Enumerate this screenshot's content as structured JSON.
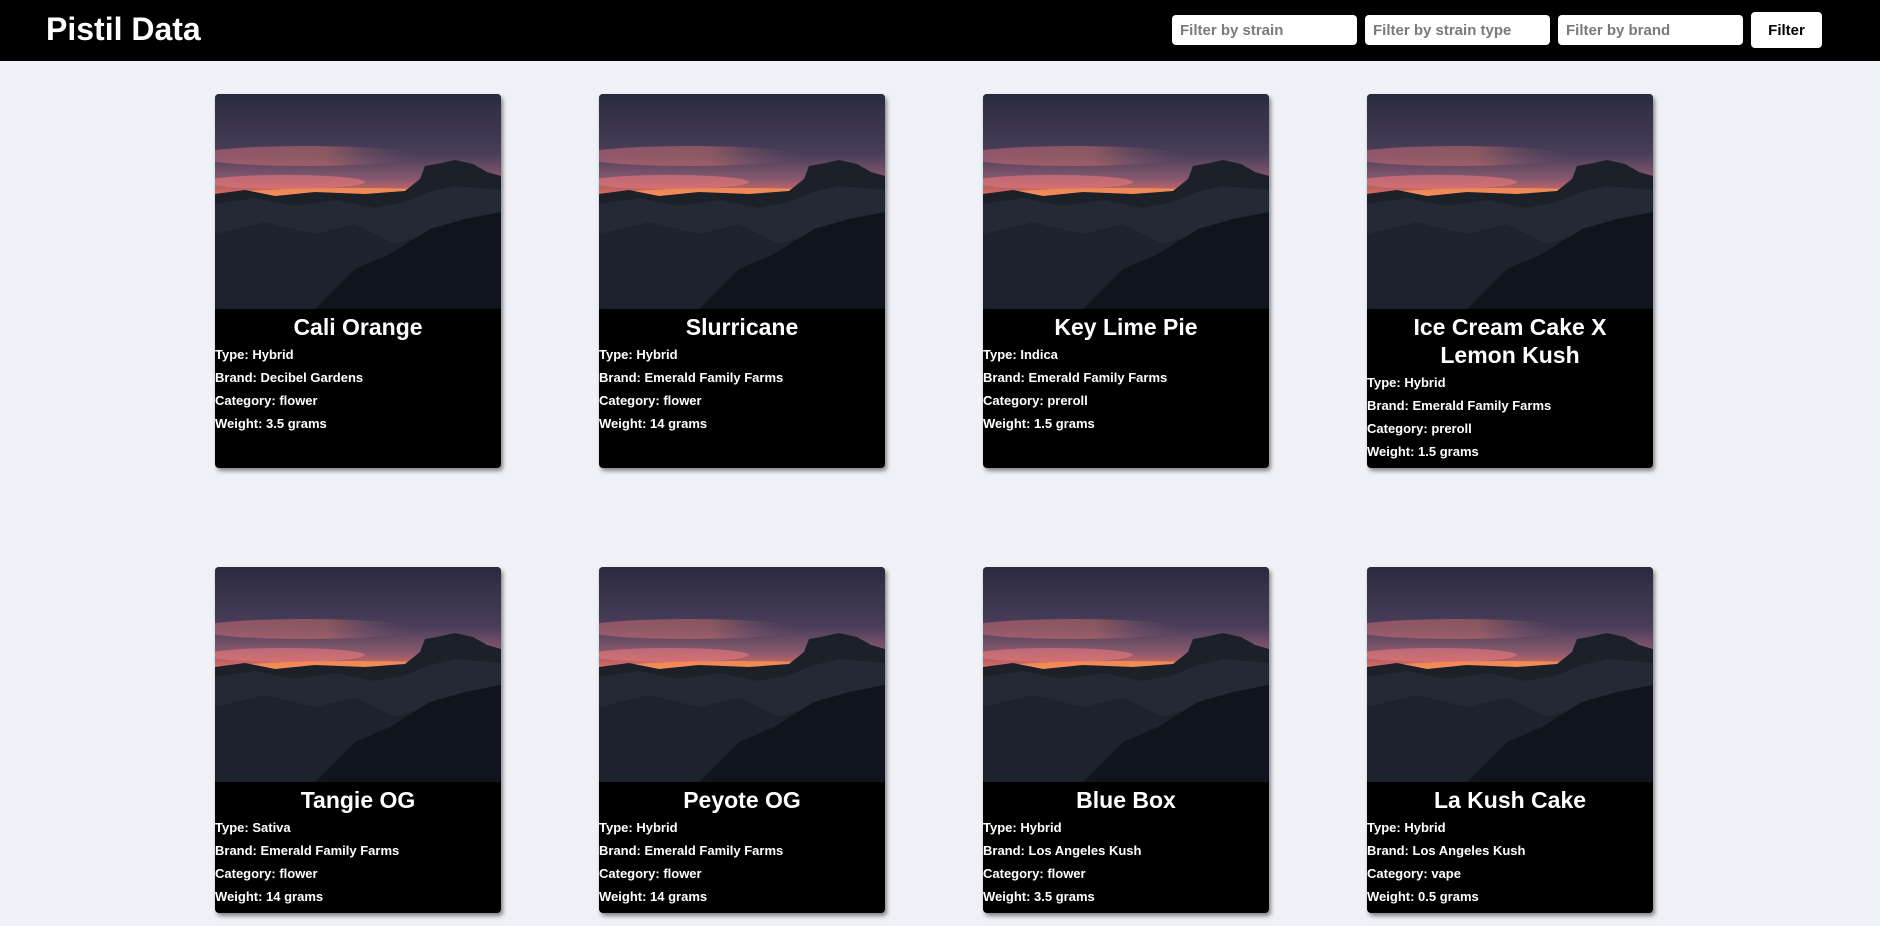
{
  "header": {
    "title": "Pistil Data",
    "strain_placeholder": "Filter by strain",
    "type_placeholder": "Filter by strain type",
    "brand_placeholder": "Filter by brand",
    "filter_label": "Filter"
  },
  "labels": {
    "type": "Type:",
    "brand": "Brand:",
    "category": "Category:",
    "weight": "Weight:"
  },
  "cards": [
    {
      "name": "Cali Orange",
      "type": "Hybrid",
      "brand": "Decibel Gardens",
      "category": "flower",
      "weight": "3.5 grams"
    },
    {
      "name": "Slurricane",
      "type": "Hybrid",
      "brand": "Emerald Family Farms",
      "category": "flower",
      "weight": "14 grams"
    },
    {
      "name": "Key Lime Pie",
      "type": "Indica",
      "brand": "Emerald Family Farms",
      "category": "preroll",
      "weight": "1.5 grams"
    },
    {
      "name": "Ice Cream Cake X Lemon Kush",
      "type": "Hybrid",
      "brand": "Emerald Family Farms",
      "category": "preroll",
      "weight": "1.5 grams"
    },
    {
      "name": "Tangie OG",
      "type": "Sativa",
      "brand": "Emerald Family Farms",
      "category": "flower",
      "weight": "14 grams"
    },
    {
      "name": "Peyote OG",
      "type": "Hybrid",
      "brand": "Emerald Family Farms",
      "category": "flower",
      "weight": "14 grams"
    },
    {
      "name": "Blue Box",
      "type": "Hybrid",
      "brand": "Los Angeles Kush",
      "category": "flower",
      "weight": "3.5 grams"
    },
    {
      "name": "La Kush Cake",
      "type": "Hybrid",
      "brand": "Los Angeles Kush",
      "category": "vape",
      "weight": "0.5 grams"
    }
  ]
}
